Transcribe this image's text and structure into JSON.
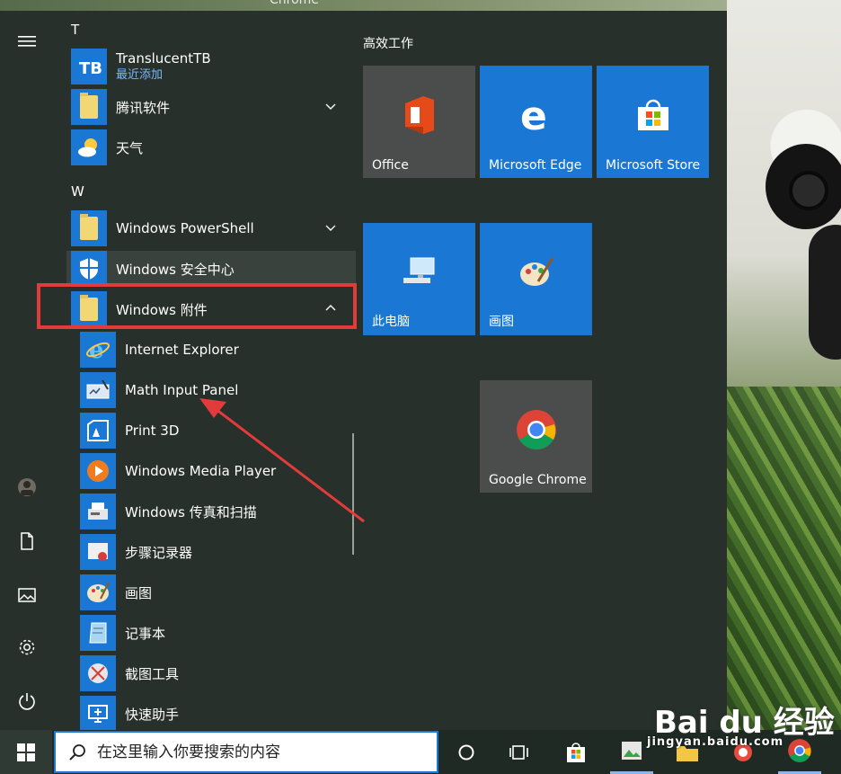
{
  "wallpaper": {
    "caption": "Chrome"
  },
  "start_menu": {
    "nav_icons": [
      "hamburger-icon",
      "avatar",
      "document-icon",
      "pictures-icon",
      "settings-icon",
      "power-icon"
    ],
    "letters": {
      "t": "T",
      "w": "W"
    },
    "apps": {
      "translucenttb": {
        "name": "TranslucentTB",
        "sub": "最近添加"
      },
      "tencent": {
        "name": "腾讯软件"
      },
      "weather": {
        "name": "天气"
      },
      "powershell": {
        "name": "Windows PowerShell"
      },
      "security": {
        "name": "Windows 安全中心"
      },
      "accessories": {
        "name": "Windows 附件"
      },
      "ie": {
        "name": "Internet Explorer"
      },
      "math": {
        "name": "Math Input Panel"
      },
      "print3d": {
        "name": "Print 3D"
      },
      "wmp": {
        "name": "Windows Media Player"
      },
      "fax": {
        "name": "Windows 传真和扫描"
      },
      "steps": {
        "name": "步骤记录器"
      },
      "paint": {
        "name": "画图"
      },
      "notepad": {
        "name": "记事本"
      },
      "snipping": {
        "name": "截图工具"
      },
      "quickassist": {
        "name": "快速助手"
      }
    },
    "tiles": {
      "group_title": "高效工作",
      "office": "Office",
      "edge": "Microsoft Edge",
      "store": "Microsoft Store",
      "pc": "此电脑",
      "paint": "画图",
      "chrome": "Google Chrome"
    }
  },
  "taskbar": {
    "search_placeholder": "在这里输入你要搜索的内容"
  },
  "watermark": {
    "logo": "Bai du 经验",
    "url": "jingyan.baidu.com"
  },
  "colors": {
    "accent": "#1a78d4",
    "highlight": "#e23b3b",
    "menu_bg": "#27302a"
  }
}
